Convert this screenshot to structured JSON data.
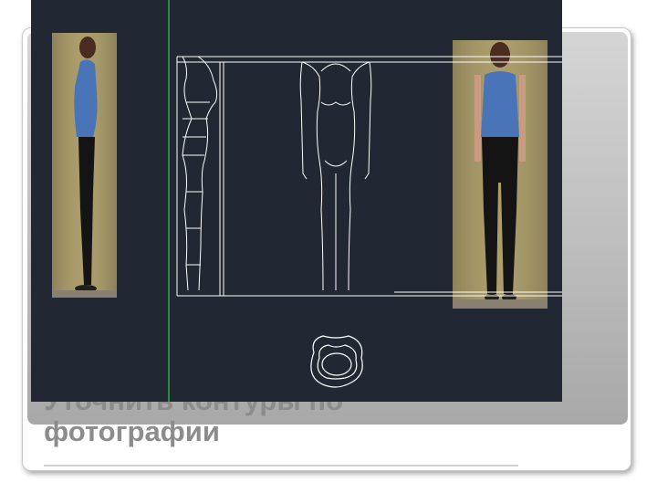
{
  "slide": {
    "title_line1": "Уточнить контуры по",
    "title_line2": "фотографии"
  },
  "cad_view": {
    "background_color": "#212833",
    "line_color": "#ffffff",
    "axis_color": "#2bd04a",
    "photo_side_label": "",
    "photo_front_label": ""
  },
  "colors": {
    "title": "#8c8c8c",
    "shirt": "#4a74b8",
    "pants": "#141414",
    "wall": "#a89a6a"
  }
}
